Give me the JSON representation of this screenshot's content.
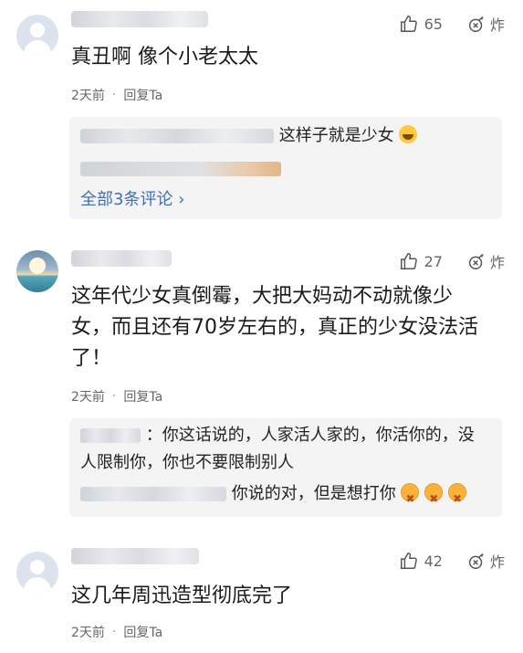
{
  "comments": [
    {
      "likes": "65",
      "blast_label": "炸",
      "text": "真丑啊  像个小老太太",
      "time": "2天前",
      "separator": "·",
      "reply_label": "回复Ta",
      "replies": [
        {
          "text": "这样子就是少女"
        }
      ],
      "more_label": "全部3条评论 ›"
    },
    {
      "likes": "27",
      "blast_label": "炸",
      "text_lines": [
        "这年代少女真倒霉，大把大妈动不动就像少",
        "女，而且还有70岁左右的，真正的少女没法活",
        "了！"
      ],
      "time": "2天前",
      "separator": "·",
      "reply_label": "回复Ta",
      "replies": [
        {
          "lines": [
            "：你这话说的，人家活人家的，你活你的，没",
            "人限制你，你也不要限制别人"
          ]
        },
        {
          "text": "你说的对，但是想打你"
        }
      ]
    },
    {
      "likes": "42",
      "blast_label": "炸",
      "text": "这几年周迅造型彻底完了",
      "time": "2天前",
      "separator": "·",
      "reply_label": "回复Ta"
    }
  ],
  "icons": {
    "like": "thumbs-up-icon",
    "blast": "bomb-icon",
    "avatar_default": "default-avatar-icon"
  },
  "colors": {
    "link": "#3f6fb5",
    "meta": "#666666",
    "reply_bg": "#f4f4f5"
  }
}
